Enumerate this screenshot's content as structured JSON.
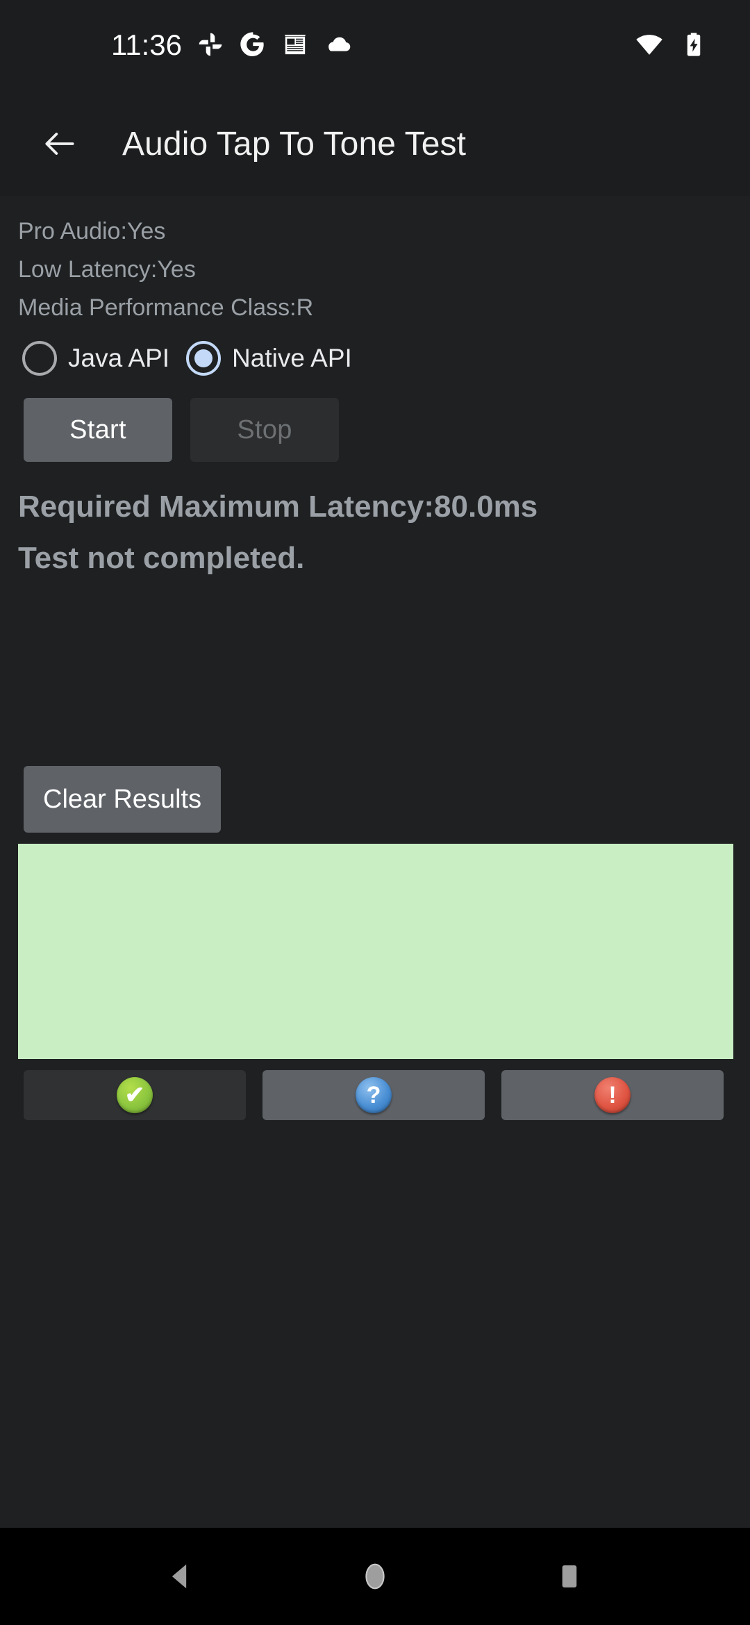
{
  "status_bar": {
    "clock": "11:36",
    "notification_icons": [
      {
        "name": "google-photos-icon"
      },
      {
        "name": "google-icon"
      },
      {
        "name": "news-icon"
      },
      {
        "name": "cloud-icon"
      }
    ],
    "system_icons": [
      {
        "name": "wifi-icon"
      },
      {
        "name": "battery-charging-icon"
      }
    ]
  },
  "app_bar": {
    "back_label": "Back",
    "title": "Audio Tap To Tone Test"
  },
  "device_info": {
    "pro_audio": "Pro Audio:Yes",
    "low_latency": "Low Latency:Yes",
    "media_performance_class": "Media Performance Class:R"
  },
  "api_selector": {
    "options": [
      {
        "label": "Java API",
        "selected": false
      },
      {
        "label": "Native API",
        "selected": true
      }
    ]
  },
  "controls": {
    "start_label": "Start",
    "start_enabled": true,
    "stop_label": "Stop",
    "stop_enabled": false
  },
  "results": {
    "required_latency": "Required Maximum Latency:80.0ms",
    "status": "Test not completed."
  },
  "clear": {
    "label": "Clear Results"
  },
  "pass_box": {
    "color": "#c9eec4",
    "text": ""
  },
  "verdict_buttons": [
    {
      "name": "pass-button",
      "glyph": "✔",
      "badge": "pass",
      "state": "dim"
    },
    {
      "name": "info-button",
      "glyph": "?",
      "badge": "info",
      "state": "lit"
    },
    {
      "name": "fail-button",
      "glyph": "!",
      "badge": "fail",
      "state": "lit"
    }
  ],
  "nav_bar": {
    "back_label": "Back",
    "home_label": "Home",
    "recents_label": "Recents"
  },
  "colors": {
    "background": "#1e2021",
    "app_bar": "#1b1d1e",
    "accent_radio": "#c3d9f7",
    "pass_green": "#8cc63f",
    "info_blue": "#4a8fd4",
    "fail_red": "#e05543",
    "pass_box_bg": "#c9eec4",
    "button_enabled": "#5f6368",
    "button_disabled": "#2b2d2e",
    "secondary_text": "#9aa0a6"
  }
}
